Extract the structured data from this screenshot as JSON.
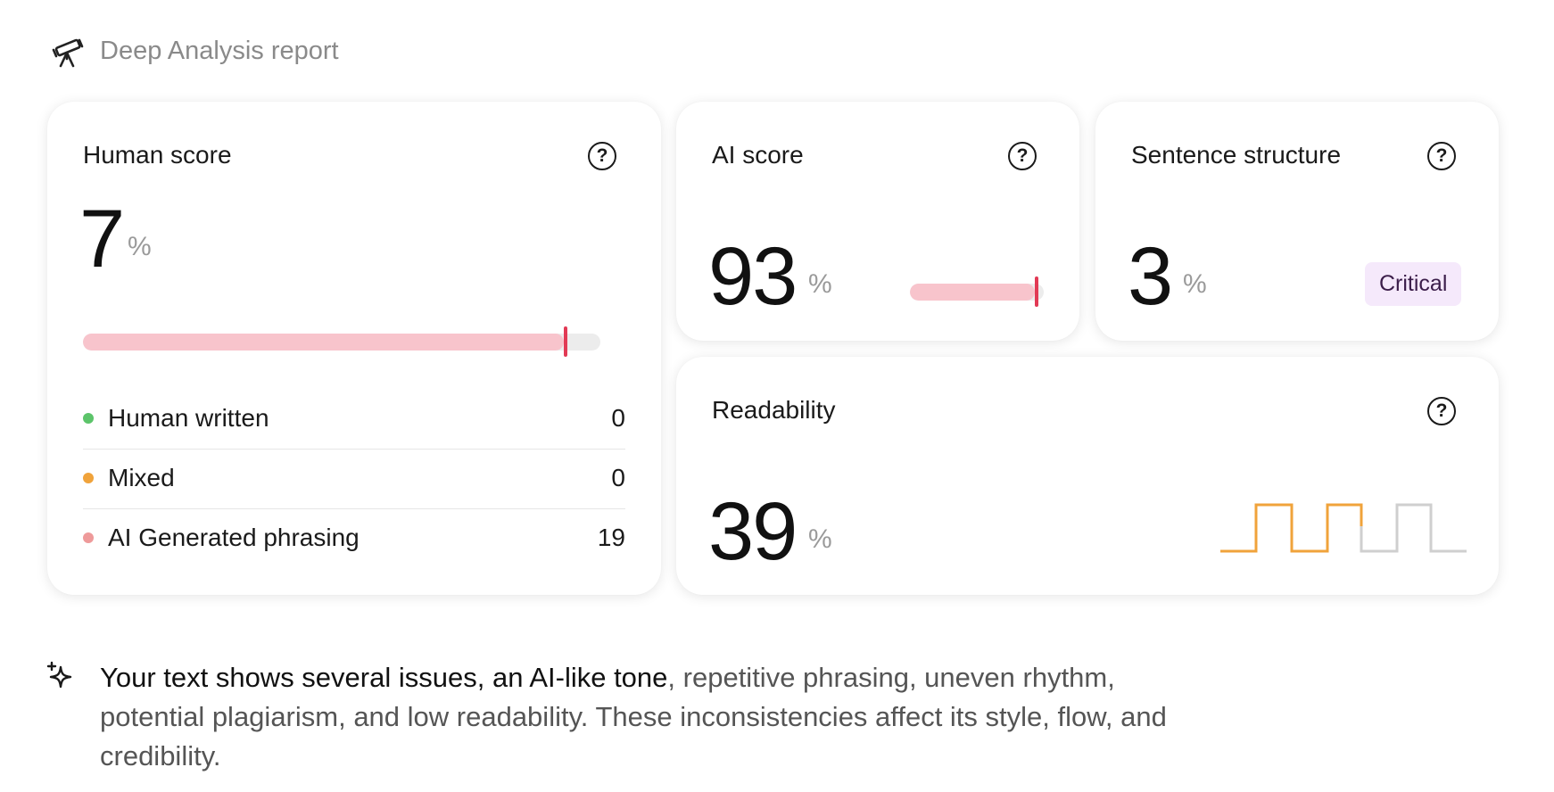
{
  "header": {
    "title": "Deep Analysis report",
    "icon": "telescope-icon"
  },
  "human_score": {
    "title": "Human score",
    "value": "7",
    "unit": "%",
    "bar_fraction": 0.93,
    "legend": [
      {
        "label": "Human written",
        "count": "0",
        "color": "#5cc46a"
      },
      {
        "label": "Mixed",
        "count": "0",
        "color": "#f0a33b"
      },
      {
        "label": "AI Generated phrasing",
        "count": "19",
        "color": "#ee9a9a"
      }
    ]
  },
  "ai_score": {
    "title": "AI score",
    "value": "93",
    "unit": "%",
    "bar_fraction": 0.93
  },
  "sentence_structure": {
    "title": "Sentence structure",
    "value": "3",
    "unit": "%",
    "badge": "Critical"
  },
  "readability": {
    "title": "Readability",
    "value": "39",
    "unit": "%",
    "active_color": "#f0a33b",
    "inactive_color": "#cfcfcf"
  },
  "insight": {
    "strong": "Your text shows several issues, an AI-like tone",
    "rest": ", repetitive phrasing, uneven rhythm, potential plagiarism, and low readability. These inconsistencies affect its style, flow, and credibility."
  },
  "colors": {
    "bar_fill": "#f8c4cc",
    "bar_marker": "#e23a55",
    "badge_bg": "#f5e9fb"
  }
}
